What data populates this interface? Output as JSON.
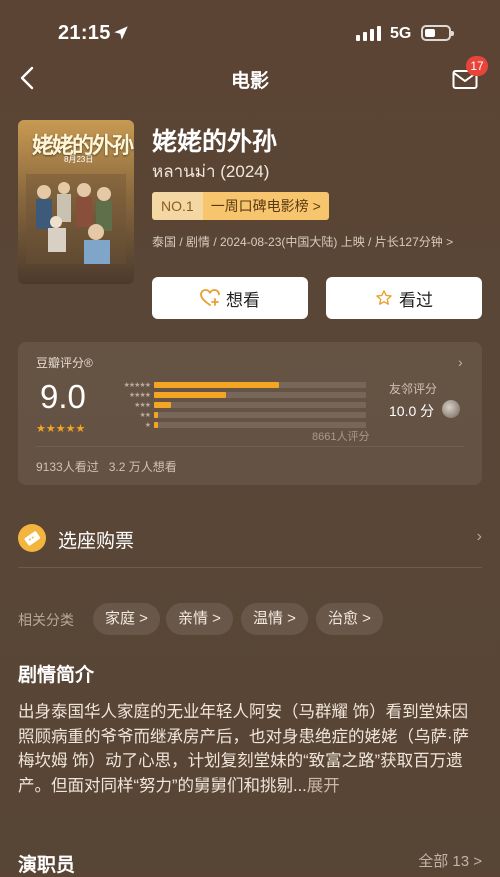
{
  "status_bar": {
    "time": "21:15",
    "network": "5G"
  },
  "nav": {
    "title": "电影",
    "badge": "17"
  },
  "movie": {
    "title": "姥姥的外孙",
    "subtitle": "หลานม่า (2024)",
    "rank_no": "NO.1",
    "rank_list": "一周口碑电影榜 >",
    "meta": "泰国 / 剧情 / 2024-08-23(中国大陆) 上映 / 片长127分钟 >",
    "poster": {
      "title": "姥姥的外孙",
      "date": "8月23日"
    }
  },
  "actions": {
    "want": "想看",
    "seen": "看过"
  },
  "rating": {
    "label": "豆瓣评分®",
    "score": "9.0",
    "stars": "★★★★★",
    "distribution": [
      {
        "stars": "★★★★★",
        "percent": 59
      },
      {
        "stars": "★★★★",
        "percent": 34
      },
      {
        "stars": "★★★",
        "percent": 8
      },
      {
        "stars": "★★",
        "percent": 2
      },
      {
        "stars": "★",
        "percent": 2
      }
    ],
    "count": "8661人评分",
    "friend_label": "友邻评分",
    "friend_score": "10.0 分",
    "seen_count": "9133人看过   3.2 万人想看"
  },
  "ticket": {
    "label": "选座购票"
  },
  "tags": {
    "label": "相关分类",
    "items": [
      "家庭 >",
      "亲情 >",
      "温情 >",
      "治愈 >"
    ]
  },
  "synopsis": {
    "title": "剧情简介",
    "text": "出身泰国华人家庭的无业年轻人阿安（马群耀 饰）看到堂妹因照顾病重的爷爷而继承房产后，也对身患绝症的姥姥（乌萨·萨梅坎姆 饰）动了心思，计划复刻堂妹的“致富之路”获取百万遗产。但面对同样“努力”的舅舅们和挑剔...",
    "expand": "展开"
  },
  "cast": {
    "title": "演职员",
    "all": "全部 13 >"
  },
  "colors": {
    "accent": "#f4a524",
    "background": "#5a4535",
    "badge": "#e8443a"
  }
}
